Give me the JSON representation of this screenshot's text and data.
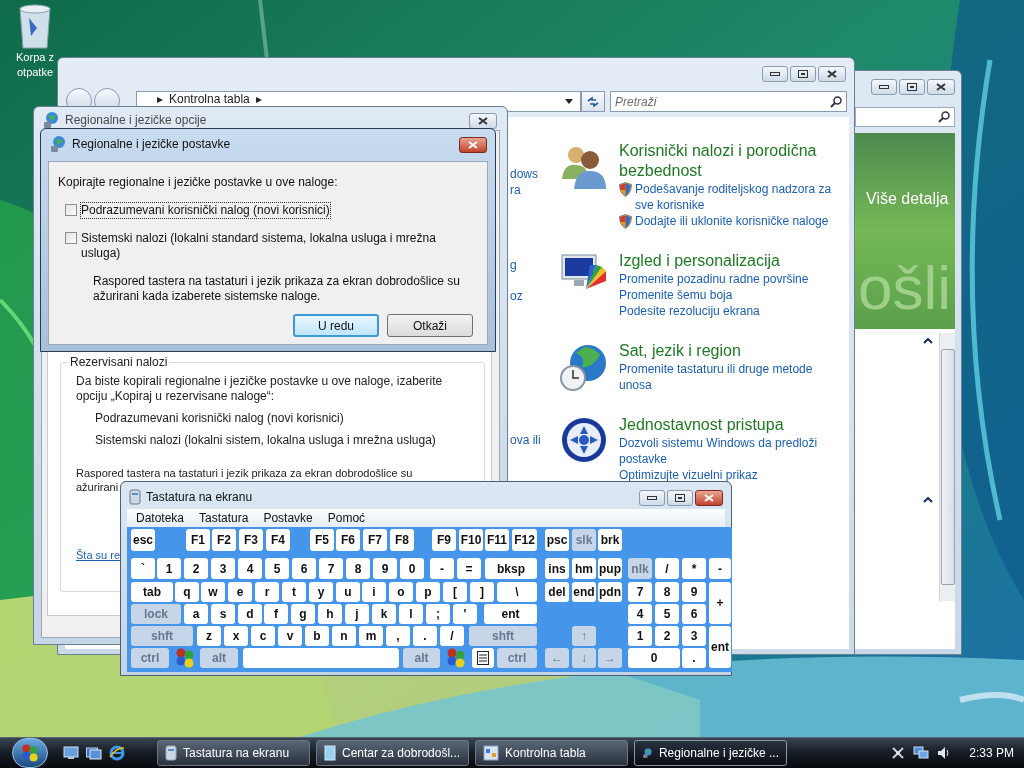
{
  "desktop": {
    "icons": [
      {
        "label_lines": [
          "Korpa z",
          "otpatke"
        ]
      }
    ]
  },
  "welcome_window": {
    "banner_link": "Više detalja",
    "banner_text": "ošli"
  },
  "control_panel": {
    "breadcrumb": [
      "▸",
      "Kontrolna tabla",
      "▸"
    ],
    "search": {
      "placeholder": "Pretraži"
    },
    "left_pane": [
      "dows",
      "ra",
      "g",
      "oz",
      "ova ili"
    ],
    "categories": [
      {
        "kind": "users",
        "title": "Korisnički nalozi i porodična bezbednost",
        "links": [
          {
            "text": "Podešavanje roditeljskog nadzora za sve korisnike",
            "shield": true
          },
          {
            "text": "Dodajte ili uklonite korisničke naloge",
            "shield": true
          }
        ]
      },
      {
        "kind": "display",
        "title": "Izgled i personalizacija",
        "links": [
          {
            "text": "Promenite pozadinu radne površine",
            "shield": false
          },
          {
            "text": "Promenite šemu boja",
            "shield": false
          },
          {
            "text": "Podesite rezoluciju ekrana",
            "shield": false
          }
        ]
      },
      {
        "kind": "globe",
        "title": "Sat, jezik i region",
        "links": [
          {
            "text": "Promenite tastaturu ili druge metode unosa",
            "shield": false
          }
        ]
      },
      {
        "kind": "access",
        "title": "Jednostavnost pristupa",
        "links": [
          {
            "text": "Dozvoli sistemu Windows da predloži postavke",
            "shield": false
          },
          {
            "text": "Optimizujte vizuelni prikaz",
            "shield": false
          }
        ]
      }
    ]
  },
  "options_dialog": {
    "title": "Regionalne i jezičke opcije",
    "group_title": "Rezervisani nalozi",
    "intro": "Da biste kopirali regionalne i jezičke postavke u ove naloge, izaberite opciju „Kopiraj u rezervisane naloge“:",
    "items": [
      "Podrazumevani korisnički nalog (novi korisnici)",
      "Sistemski nalozi (lokalni sistem, lokalna usluga i mrežna usluga)"
    ],
    "note": "Raspored tastera na tastaturi i jezik prikaza za ekran dobrodošlice su ažurirani",
    "link": "Šta su re"
  },
  "dialog": {
    "title": "Regionalne i jezičke postavke",
    "prompt": "Kopirajte regionalne i jezičke postavke u ove naloge:",
    "checkboxes": [
      {
        "label": "Podrazumevani korisnički nalog (novi korisnici)",
        "checked": false,
        "focused": true
      },
      {
        "label": "Sistemski nalozi (lokalni standard sistema, lokalna usluga i mrežna usluga)",
        "checked": false,
        "focused": false
      }
    ],
    "note": "Raspored tastera na tastaturi i jezik prikaza za ekran dobrodošlice su ažurirani kada izaberete sistemske naloge.",
    "buttons": [
      {
        "label": "U redu",
        "default": true
      },
      {
        "label": "Otkaži",
        "default": false
      }
    ]
  },
  "osk": {
    "title": "Tastatura na ekranu",
    "menu": [
      "Datoteka",
      "Tastatura",
      "Postavke",
      "Pomoć"
    ],
    "keys": [
      {
        "label": "esc",
        "kind": "key"
      },
      {
        "label": "F1",
        "kind": "key"
      },
      {
        "label": "F2",
        "kind": "key"
      },
      {
        "label": "F3",
        "kind": "key"
      },
      {
        "label": "F4",
        "kind": "key"
      },
      {
        "label": "F5",
        "kind": "key"
      },
      {
        "label": "F6",
        "kind": "key"
      },
      {
        "label": "F7",
        "kind": "key"
      },
      {
        "label": "F8",
        "kind": "key"
      },
      {
        "label": "F9",
        "kind": "key"
      },
      {
        "label": "F10",
        "kind": "key"
      },
      {
        "label": "F11",
        "kind": "key"
      },
      {
        "label": "F12",
        "kind": "key"
      },
      {
        "label": "psc",
        "kind": "key"
      },
      {
        "label": "slk",
        "kind": "toggle"
      },
      {
        "label": "brk",
        "kind": "key"
      },
      {
        "label": "`",
        "kind": "key"
      },
      {
        "label": "1",
        "kind": "key"
      },
      {
        "label": "2",
        "kind": "key"
      },
      {
        "label": "3",
        "kind": "key"
      },
      {
        "label": "4",
        "kind": "key"
      },
      {
        "label": "5",
        "kind": "key"
      },
      {
        "label": "6",
        "kind": "key"
      },
      {
        "label": "7",
        "kind": "key"
      },
      {
        "label": "8",
        "kind": "key"
      },
      {
        "label": "9",
        "kind": "key"
      },
      {
        "label": "0",
        "kind": "key"
      },
      {
        "label": "-",
        "kind": "key"
      },
      {
        "label": "=",
        "kind": "key"
      },
      {
        "label": "bksp",
        "kind": "key"
      },
      {
        "label": "ins",
        "kind": "key"
      },
      {
        "label": "hm",
        "kind": "key"
      },
      {
        "label": "pup",
        "kind": "key"
      },
      {
        "label": "nlk",
        "kind": "toggle"
      },
      {
        "label": "/",
        "kind": "key"
      },
      {
        "label": "*",
        "kind": "key"
      },
      {
        "label": "-",
        "kind": "key"
      },
      {
        "label": "tab",
        "kind": "key"
      },
      {
        "label": "q",
        "kind": "key"
      },
      {
        "label": "w",
        "kind": "key"
      },
      {
        "label": "e",
        "kind": "key"
      },
      {
        "label": "r",
        "kind": "key"
      },
      {
        "label": "t",
        "kind": "key"
      },
      {
        "label": "y",
        "kind": "key"
      },
      {
        "label": "u",
        "kind": "key"
      },
      {
        "label": "i",
        "kind": "key"
      },
      {
        "label": "o",
        "kind": "key"
      },
      {
        "label": "p",
        "kind": "key"
      },
      {
        "label": "[",
        "kind": "key"
      },
      {
        "label": "]",
        "kind": "key"
      },
      {
        "label": "\\",
        "kind": "key"
      },
      {
        "label": "del",
        "kind": "key"
      },
      {
        "label": "end",
        "kind": "key"
      },
      {
        "label": "pdn",
        "kind": "key"
      },
      {
        "label": "7",
        "kind": "key"
      },
      {
        "label": "8",
        "kind": "key"
      },
      {
        "label": "9",
        "kind": "key"
      },
      {
        "label": "+",
        "kind": "key"
      },
      {
        "label": "lock",
        "kind": "toggle"
      },
      {
        "label": "a",
        "kind": "key"
      },
      {
        "label": "s",
        "kind": "key"
      },
      {
        "label": "d",
        "kind": "key"
      },
      {
        "label": "f",
        "kind": "key"
      },
      {
        "label": "g",
        "kind": "key"
      },
      {
        "label": "h",
        "kind": "key"
      },
      {
        "label": "j",
        "kind": "key"
      },
      {
        "label": "k",
        "kind": "key"
      },
      {
        "label": "l",
        "kind": "key"
      },
      {
        "label": ";",
        "kind": "key"
      },
      {
        "label": "'",
        "kind": "key"
      },
      {
        "label": "ent",
        "kind": "key"
      },
      {
        "label": "4",
        "kind": "key"
      },
      {
        "label": "5",
        "kind": "key"
      },
      {
        "label": "6",
        "kind": "key"
      },
      {
        "label": "shft",
        "kind": "toggle"
      },
      {
        "label": "z",
        "kind": "key"
      },
      {
        "label": "x",
        "kind": "key"
      },
      {
        "label": "c",
        "kind": "key"
      },
      {
        "label": "v",
        "kind": "key"
      },
      {
        "label": "b",
        "kind": "key"
      },
      {
        "label": "n",
        "kind": "key"
      },
      {
        "label": "m",
        "kind": "key"
      },
      {
        "label": ",",
        "kind": "key"
      },
      {
        "label": ".",
        "kind": "key"
      },
      {
        "label": "/",
        "kind": "key"
      },
      {
        "label": "shft",
        "kind": "toggle"
      },
      {
        "label": "↑",
        "kind": "toggle"
      },
      {
        "label": "1",
        "kind": "key"
      },
      {
        "label": "2",
        "kind": "key"
      },
      {
        "label": "3",
        "kind": "key"
      },
      {
        "label": "ent",
        "kind": "key"
      },
      {
        "label": "ctrl",
        "kind": "toggle"
      },
      {
        "kind": "windows"
      },
      {
        "label": "alt",
        "kind": "toggle"
      },
      {
        "kind": "space"
      },
      {
        "label": "alt",
        "kind": "toggle"
      },
      {
        "kind": "windows"
      },
      {
        "kind": "menu"
      },
      {
        "label": "ctrl",
        "kind": "toggle"
      },
      {
        "label": "←",
        "kind": "toggle"
      },
      {
        "label": "↓",
        "kind": "toggle"
      },
      {
        "label": "→",
        "kind": "toggle"
      },
      {
        "label": "0",
        "kind": "key"
      },
      {
        "label": ".",
        "kind": "key"
      }
    ]
  },
  "taskbar": {
    "buttons": [
      {
        "label": "Tastatura na ekranu",
        "kind": "keyboard",
        "selected": false
      },
      {
        "label": "Centar za dobrodošl...",
        "kind": "welcome",
        "selected": false
      },
      {
        "label": "Kontrolna tabla",
        "kind": "panel",
        "selected": false
      },
      {
        "label": "Regionalne i jezičke ...",
        "kind": "globe",
        "selected": true
      }
    ],
    "clock": "2:33 PM"
  }
}
